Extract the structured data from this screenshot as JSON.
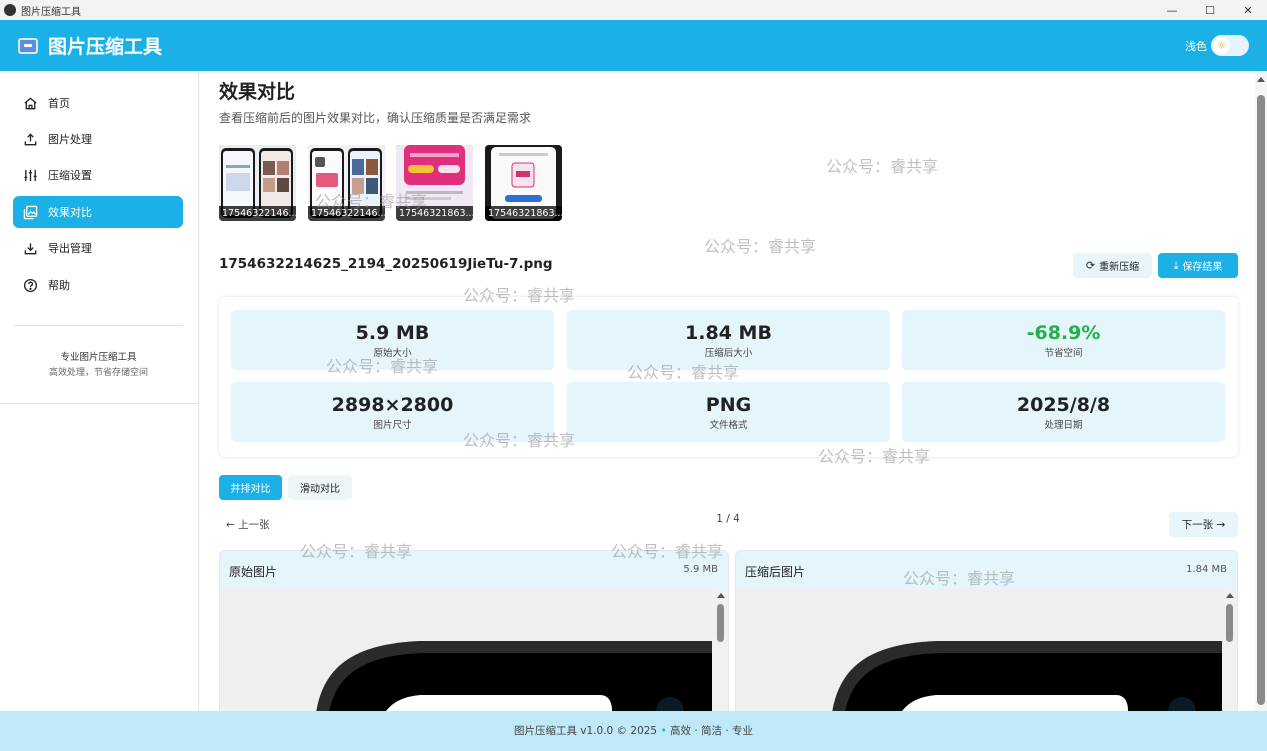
{
  "window": {
    "title": "图片压缩工具",
    "controls": [
      "—",
      "☐",
      "✕"
    ]
  },
  "header": {
    "title": "图片压缩工具",
    "theme_label": "浅色",
    "theme_icon": "☼"
  },
  "sidebar": {
    "items": [
      {
        "label": "首页",
        "icon": "home-icon"
      },
      {
        "label": "图片处理",
        "icon": "upload-icon"
      },
      {
        "label": "压缩设置",
        "icon": "sliders-icon"
      },
      {
        "label": "效果对比",
        "icon": "image-compare-icon",
        "active": true
      },
      {
        "label": "导出管理",
        "icon": "download-icon"
      },
      {
        "label": "帮助",
        "icon": "help-icon"
      }
    ],
    "slogan_title": "专业图片压缩工具",
    "slogan_sub": "高效处理，节省存储空间"
  },
  "page": {
    "title": "效果对比",
    "subtitle": "查看压缩前后的图片效果对比，确认压缩质量是否满足需求"
  },
  "thumbnails": [
    {
      "label": "17546322146..."
    },
    {
      "label": "17546322146..."
    },
    {
      "label": "17546321863..."
    },
    {
      "label": "17546321863..."
    }
  ],
  "file": {
    "name": "1754632214625_2194_20250619JieTu-7.png",
    "recompress_label": "重新压缩",
    "save_label": "保存结果"
  },
  "stats": [
    {
      "value": "5.9 MB",
      "label": "原始大小"
    },
    {
      "value": "1.84 MB",
      "label": "压缩后大小"
    },
    {
      "value": "-68.9%",
      "label": "节省空间"
    },
    {
      "value": "2898×2800",
      "label": "图片尺寸"
    },
    {
      "value": "PNG",
      "label": "文件格式"
    },
    {
      "value": "2025/8/8",
      "label": "处理日期"
    }
  ],
  "modes": {
    "side_by_side": "并排对比",
    "slide": "滑动对比"
  },
  "pager": {
    "prev": "← 上一张",
    "indicator": "1 / 4",
    "next": "下一张 →"
  },
  "panels": {
    "original_title": "原始图片",
    "original_size": "5.9 MB",
    "compressed_title": "压缩后图片",
    "compressed_size": "1.84 MB"
  },
  "footer": {
    "left": "图片压缩工具 v1.0.0 © 2025",
    "dot": "•",
    "right": "高效 · 简洁 · 专业"
  },
  "watermark": "公众号：睿共享",
  "colors": {
    "accent": "#1cb1e6",
    "stat_bg": "#e5f5fc",
    "success": "#22b14c"
  }
}
